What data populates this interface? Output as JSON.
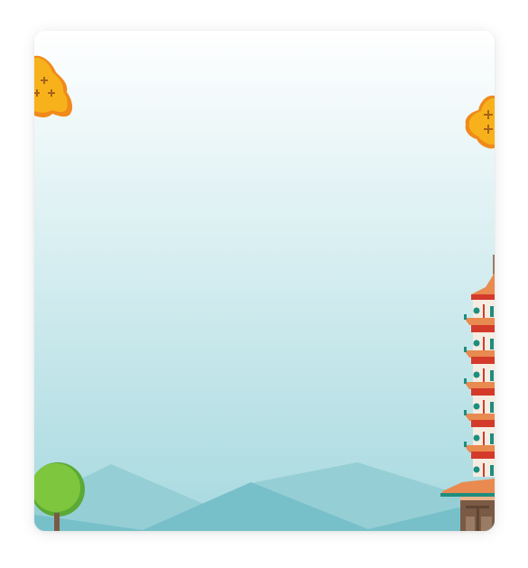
{
  "scene": {
    "sky_top": "#ffffff",
    "sky_bottom": "#a6d9df",
    "mountain_back": "#96ced5",
    "mountain_front": "#77c0c9",
    "mountain_base": "#6bb9c2",
    "foliage_color": "#f7b21b",
    "foliage_rim": "#f08a1b",
    "tree_color": "#7ec63e",
    "pagoda_roof": "#e98a50",
    "pagoda_rail": "#d43a2a",
    "pagoda_trim": "#1f8d7e",
    "pagoda_wall": "#f5ece2",
    "gate_color": "#7a5a44"
  },
  "icons": {
    "top_left": "autumn-foliage-icon",
    "top_right": "autumn-foliage-icon",
    "bottom_left": "tree-icon",
    "bottom_right": "pagoda-icon"
  }
}
